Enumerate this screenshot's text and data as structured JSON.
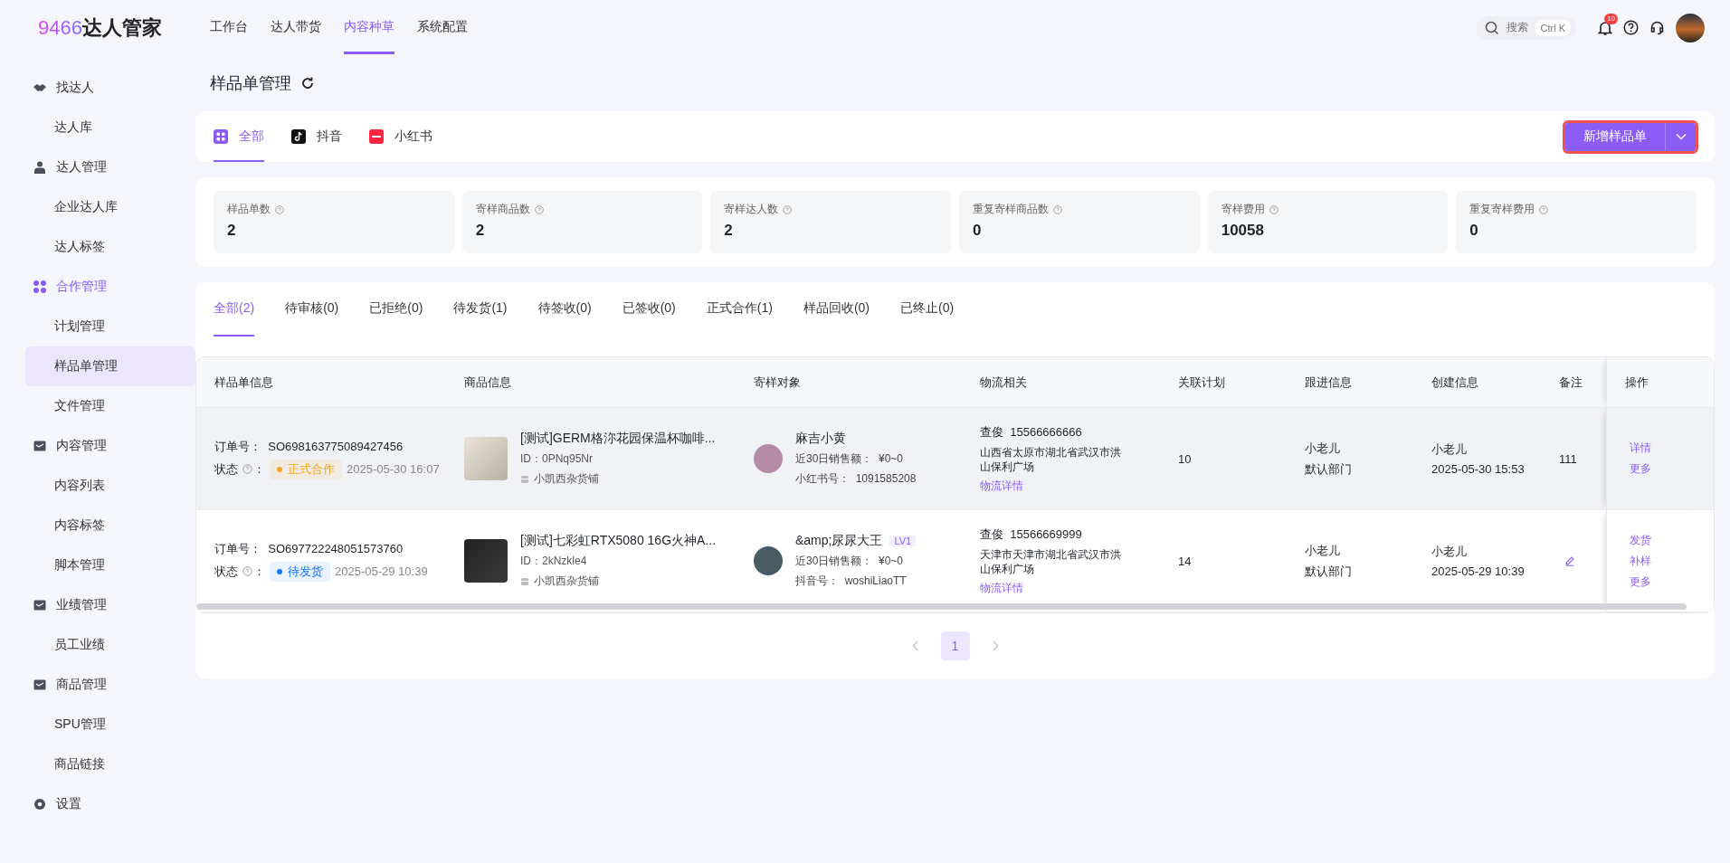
{
  "logo": {
    "number": "9466",
    "text": "达人管家"
  },
  "top_nav": [
    {
      "label": "工作台",
      "selected": false
    },
    {
      "label": "达人带货",
      "selected": false
    },
    {
      "label": "内容种草",
      "selected": true
    },
    {
      "label": "系统配置",
      "selected": false
    }
  ],
  "search": {
    "placeholder": "搜索",
    "shortcut": "Ctrl K"
  },
  "notifications": {
    "count": "10"
  },
  "sidebar": {
    "sections": [
      {
        "label": "找达人",
        "children": [
          {
            "label": "达人库",
            "selected": false
          }
        ]
      },
      {
        "label": "达人管理",
        "children": [
          {
            "label": "企业达人库",
            "selected": false
          },
          {
            "label": "达人标签",
            "selected": false
          }
        ]
      },
      {
        "label": "合作管理",
        "children": [
          {
            "label": "计划管理",
            "selected": false
          },
          {
            "label": "样品单管理",
            "selected": true
          },
          {
            "label": "文件管理",
            "selected": false
          }
        ]
      },
      {
        "label": "内容管理",
        "children": [
          {
            "label": "内容列表",
            "selected": false
          },
          {
            "label": "内容标签",
            "selected": false
          },
          {
            "label": "脚本管理",
            "selected": false
          }
        ]
      },
      {
        "label": "业绩管理",
        "children": [
          {
            "label": "员工业绩",
            "selected": false
          }
        ]
      },
      {
        "label": "商品管理",
        "children": [
          {
            "label": "SPU管理",
            "selected": false
          },
          {
            "label": "商品链接",
            "selected": false
          }
        ]
      },
      {
        "label": "设置"
      }
    ]
  },
  "page_title": "样品单管理",
  "platform_tabs": [
    {
      "label": "全部",
      "kind": "all",
      "selected": true
    },
    {
      "label": "抖音",
      "kind": "douyin",
      "selected": false
    },
    {
      "label": "小红书",
      "kind": "xiaohongshu",
      "selected": false
    }
  ],
  "new_button": {
    "label": "新增样品单",
    "highlighted": true
  },
  "stats": [
    {
      "label": "样品单数",
      "value": "2"
    },
    {
      "label": "寄样商品数",
      "value": "2"
    },
    {
      "label": "寄样达人数",
      "value": "2"
    },
    {
      "label": "重复寄样商品数",
      "value": "0"
    },
    {
      "label": "寄样费用",
      "value": "10058"
    },
    {
      "label": "重复寄样费用",
      "value": "0"
    }
  ],
  "status_tabs": [
    {
      "label": "全部(2)",
      "selected": true
    },
    {
      "label": "待审核(0)",
      "selected": false
    },
    {
      "label": "已拒绝(0)",
      "selected": false
    },
    {
      "label": "待发货(1)",
      "selected": false
    },
    {
      "label": "待签收(0)",
      "selected": false
    },
    {
      "label": "已签收(0)",
      "selected": false
    },
    {
      "label": "正式合作(1)",
      "selected": false
    },
    {
      "label": "样品回收(0)",
      "selected": false
    },
    {
      "label": "已终止(0)",
      "selected": false
    }
  ],
  "table": {
    "columns": [
      "样品单信息",
      "商品信息",
      "寄样对象",
      "物流相关",
      "关联计划",
      "跟进信息",
      "创建信息",
      "备注",
      "操作"
    ],
    "rows": [
      {
        "hovered": true,
        "order_label": "订单号：",
        "order_no": "SO698163775089427456",
        "status_label": "状态",
        "status_colon": "：",
        "status": {
          "text": "正式合作",
          "color": "#f5a623"
        },
        "status_time": "2025-05-30 16:07",
        "product": {
          "title": "[测试]GERM格沵花园保温杯咖啡...",
          "id": "ID：0PNq95Nr",
          "shop": "小凯西杂货铺"
        },
        "target": {
          "name": "麻吉小黄",
          "sales_label": "近30日销售额：",
          "sales": "¥0~0",
          "account_label": "小红书号：",
          "account": "1091585208"
        },
        "logistics": {
          "contact": "查俊",
          "phone": "15566666666",
          "address": "山西省太原市湖北省武汉市洪山保利广场",
          "link": "物流详情"
        },
        "plan": "10",
        "follow": [
          "小老儿",
          "默认部门"
        ],
        "created": [
          "小老儿",
          "2025-05-30 15:53"
        ],
        "note": {
          "kind": "text",
          "text": "111"
        },
        "actions": [
          "详情",
          "更多"
        ]
      },
      {
        "hovered": false,
        "order_label": "订单号：",
        "order_no": "SO697722248051573760",
        "status_label": "状态",
        "status_colon": "：",
        "status": {
          "text": "待发货",
          "color": "#1677ff"
        },
        "status_time": "2025-05-29 10:39",
        "product": {
          "title": "[测试]七彩虹RTX5080 16G火神A...",
          "id": "ID：2kNzkle4",
          "shop": "小凯西杂货铺"
        },
        "target": {
          "name": "&amp;尿尿大王",
          "level": "LV1",
          "sales_label": "近30日销售额：",
          "sales": "¥0~0",
          "account_label": "抖音号：",
          "account": "woshiLiaoTT"
        },
        "logistics": {
          "contact": "查俊",
          "phone": "15566669999",
          "address": "天津市天津市湖北省武汉市洪山保利广场",
          "link": "物流详情"
        },
        "plan": "14",
        "follow": [
          "小老儿",
          "默认部门"
        ],
        "created": [
          "小老儿",
          "2025-05-29 10:39"
        ],
        "note": {
          "kind": "edit"
        },
        "actions": [
          "发货",
          "补样",
          "更多"
        ]
      }
    ]
  },
  "pagination": {
    "pages": [
      {
        "label": "1",
        "selected": true
      }
    ]
  }
}
